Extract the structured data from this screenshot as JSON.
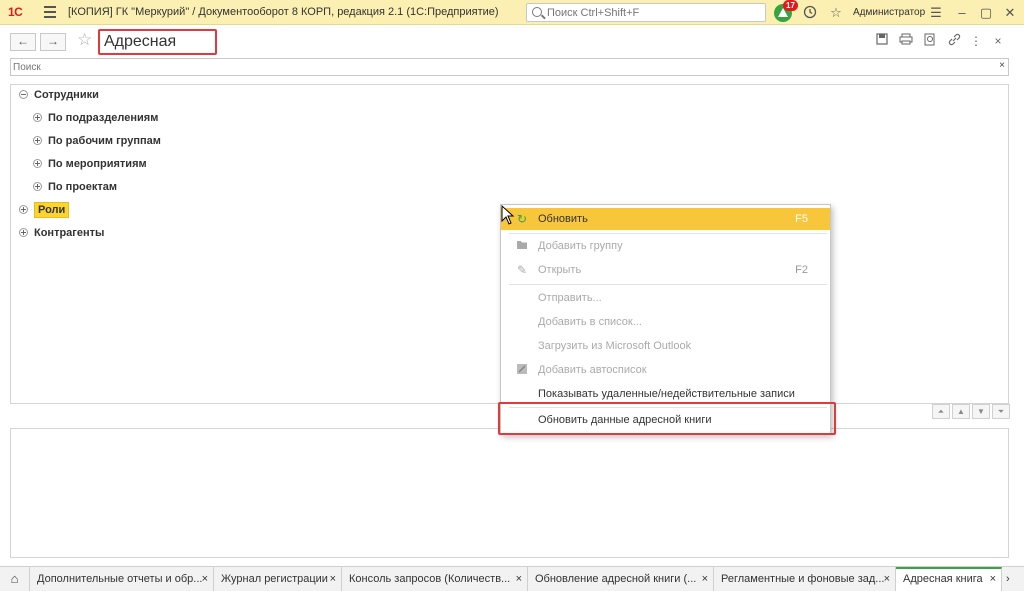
{
  "titlebar": {
    "logo": "1С",
    "title": "[КОПИЯ] ГК \"Меркурий\" / Документооборот 8 КОРП, редакция 2.1  (1С:Предприятие)",
    "search_placeholder": "Поиск Ctrl+Shift+F",
    "notification_count": "17",
    "user": "Администратор",
    "icons": [
      "menu-icon",
      "search-icon",
      "notification-icon",
      "history-icon",
      "star-icon",
      "settings-icon",
      "minimize-icon",
      "maximize-icon",
      "close-icon"
    ]
  },
  "form": {
    "title": "Адресная книга",
    "back_glyph": "←",
    "forward_glyph": "→",
    "star_glyph": "☆",
    "header_icons": [
      "save-icon",
      "print-icon",
      "preview-icon",
      "link-icon",
      "more-icon",
      "close-icon"
    ],
    "search_placeholder": "Поиск",
    "search_clear": "×"
  },
  "tree": {
    "items": [
      {
        "label": "Сотрудники",
        "level": 0,
        "expanded": true
      },
      {
        "label": "По подразделениям",
        "level": 1,
        "expanded": false
      },
      {
        "label": "По рабочим группам",
        "level": 1,
        "expanded": false
      },
      {
        "label": "По мероприятиям",
        "level": 1,
        "expanded": false
      },
      {
        "label": "По проектам",
        "level": 1,
        "expanded": false
      },
      {
        "label": "Роли",
        "level": 0,
        "expanded": false,
        "selected": true
      },
      {
        "label": "Контрагенты",
        "level": 0,
        "expanded": false
      }
    ]
  },
  "context_menu": {
    "items": [
      {
        "label": "Обновить",
        "shortcut": "F5",
        "icon": "refresh-icon",
        "enabled": true,
        "highlighted": true
      },
      {
        "label": "Добавить группу",
        "shortcut": "",
        "icon": "add-folder-icon",
        "enabled": false
      },
      {
        "label": "Открыть",
        "shortcut": "F2",
        "icon": "pencil-icon",
        "enabled": false
      },
      {
        "label": "Отправить...",
        "shortcut": "",
        "icon": "",
        "enabled": false
      },
      {
        "label": "Добавить в список...",
        "shortcut": "",
        "icon": "",
        "enabled": false
      },
      {
        "label": "Загрузить из Microsoft Outlook",
        "shortcut": "",
        "icon": "",
        "enabled": false
      },
      {
        "label": "Добавить автосписок",
        "shortcut": "",
        "icon": "autolist-icon",
        "enabled": false
      },
      {
        "label": "Показывать удаленные/недействительные записи",
        "shortcut": "",
        "icon": "",
        "enabled": true
      },
      {
        "label": "Обновить данные адресной книги",
        "shortcut": "",
        "icon": "",
        "enabled": true
      }
    ]
  },
  "tabs": [
    {
      "label": "Дополнительные отчеты и обр...",
      "close": "×",
      "active": false
    },
    {
      "label": "Журнал регистрации",
      "close": "×",
      "active": false
    },
    {
      "label": "Консоль запросов (Количеств...",
      "close": "×",
      "active": false
    },
    {
      "label": "Обновление адресной книги (...",
      "close": "×",
      "active": false
    },
    {
      "label": "Регламентные и фоновые зад...",
      "close": "×",
      "active": false
    },
    {
      "label": "Адресная книга",
      "close": "×",
      "active": true
    }
  ],
  "colors": {
    "titlebar_bg": "#fbf0b2",
    "highlight": "#f7c63b",
    "selection": "#fdd42d",
    "annotation_red": "#e0393e",
    "notification_green": "#37a441",
    "logo_red": "#e1191b"
  }
}
